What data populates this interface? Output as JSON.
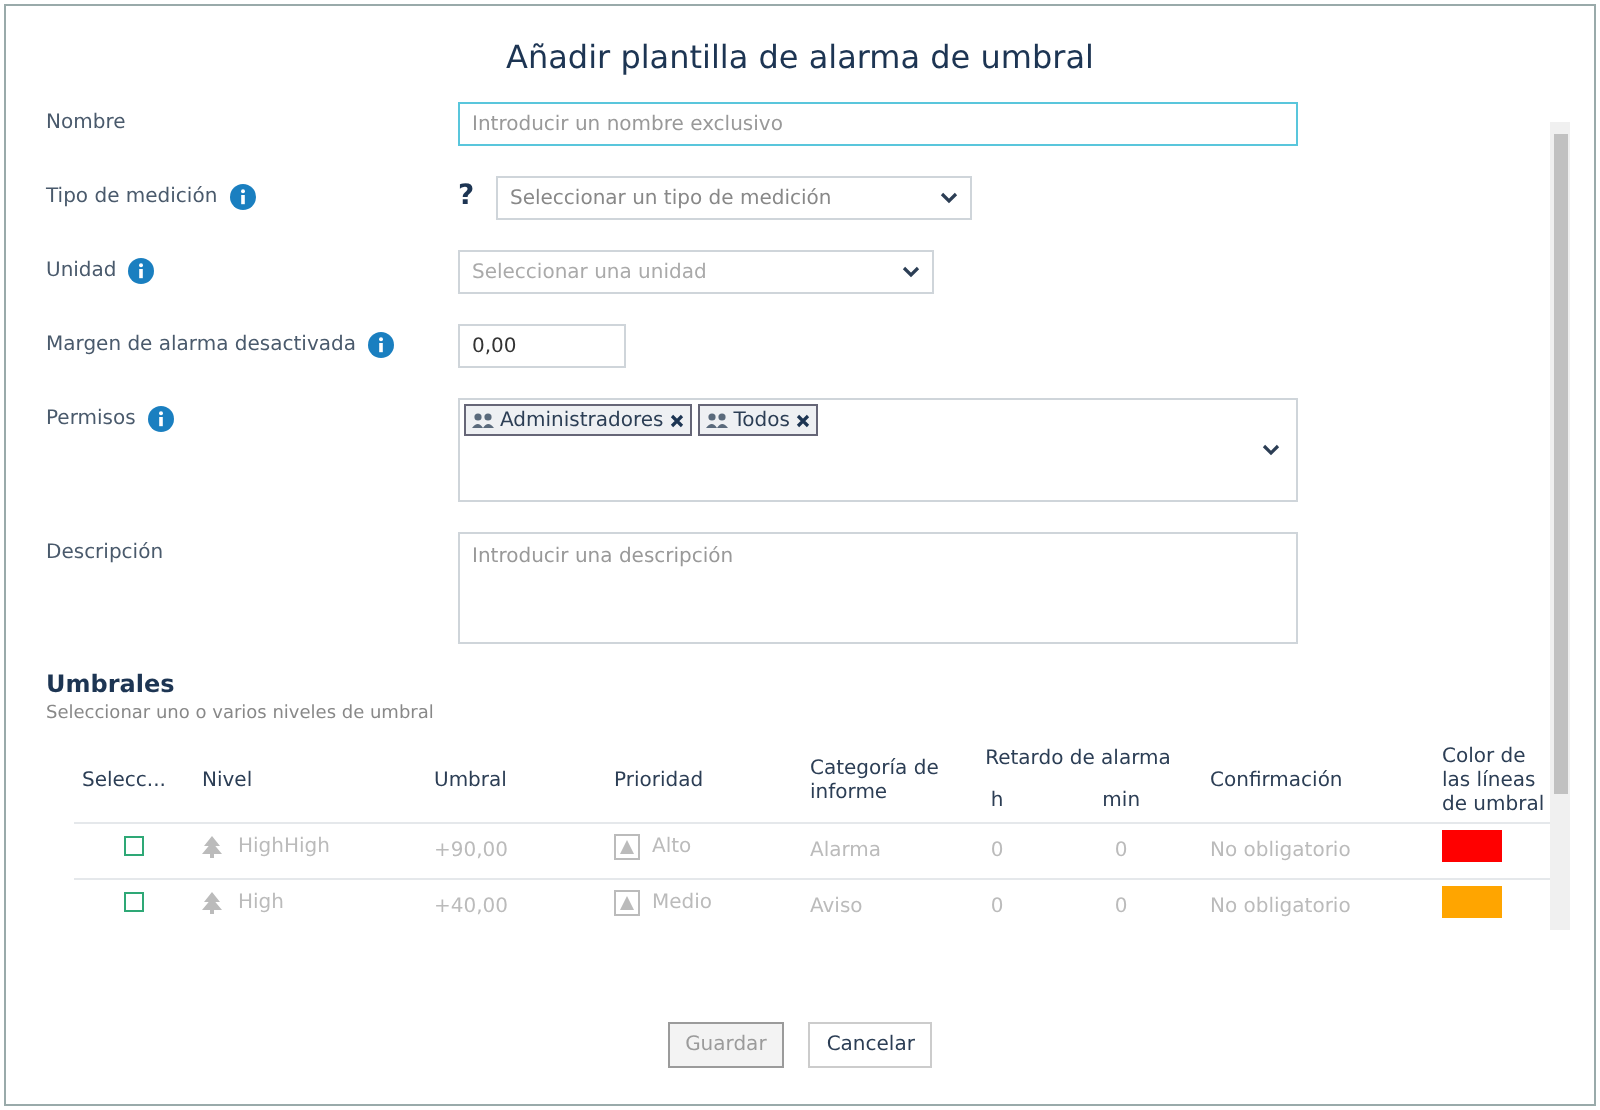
{
  "dialog": {
    "title": "Añadir plantilla de alarma de umbral"
  },
  "fields": [
    {
      "kind": "text",
      "label": "Nombre",
      "info": false,
      "placeholder": "Introducir un nombre exclusivo",
      "focused": true
    },
    {
      "kind": "select",
      "label": "Tipo de medición",
      "info": true,
      "help": "?",
      "placeholder": "Seleccionar un tipo de medición"
    },
    {
      "kind": "select",
      "label": "Unidad",
      "info": true,
      "placeholder": "Seleccionar una unidad",
      "disabled": true
    },
    {
      "kind": "number",
      "label": "Margen de alarma desactivada",
      "info": true,
      "value": "0,00"
    },
    {
      "kind": "tags",
      "label": "Permisos",
      "info": true,
      "tags": [
        "Administradores",
        "Todos"
      ]
    },
    {
      "kind": "textarea",
      "label": "Descripción",
      "info": false,
      "placeholder": "Introducir una descripción"
    }
  ],
  "thresholds": {
    "title": "Umbrales",
    "subtitle": "Seleccionar uno o varios niveles de umbral",
    "columns": [
      "Selecc...",
      "Nivel",
      "Umbral",
      "Prioridad",
      "Categoría de informe",
      "Retardo de alarma",
      "Confirmación",
      "Color de las líneas de umbral"
    ],
    "subcolumns": [
      "h",
      "min"
    ],
    "rows": [
      {
        "checked": false,
        "level": "HighHigh",
        "threshold": "+90,00",
        "priority": "Alto",
        "category": "Alarma",
        "h": "0",
        "min": "0",
        "confirmation": "No obligatorio",
        "color": "#ff0000"
      },
      {
        "checked": false,
        "level": "High",
        "threshold": "+40,00",
        "priority": "Medio",
        "category": "Aviso",
        "h": "0",
        "min": "0",
        "confirmation": "No obligatorio",
        "color": "#ffa500"
      }
    ]
  },
  "buttons": [
    {
      "label": "Guardar",
      "disabled": true
    },
    {
      "label": "Cancelar",
      "disabled": false
    }
  ]
}
